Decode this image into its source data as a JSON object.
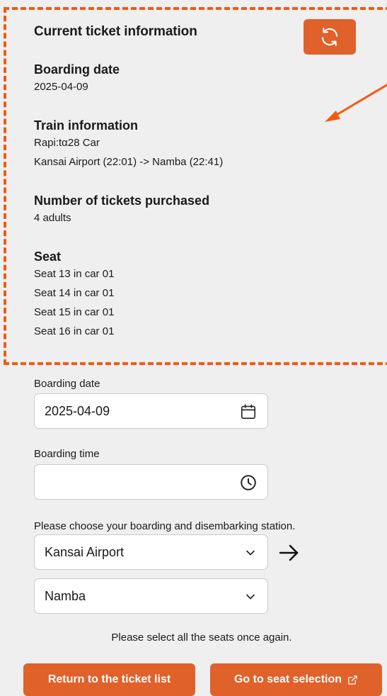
{
  "current_ticket": {
    "title": "Current ticket information",
    "boarding_date_label": "Boarding date",
    "boarding_date": "2025-04-09",
    "train_info_label": "Train information",
    "train_name": "Rapi:tα28 Car",
    "route": "Kansai Airport (22:01) -> Namba (22:41)",
    "tickets_label": "Number of tickets purchased",
    "tickets": "4 adults",
    "seat_label": "Seat",
    "seats": [
      "Seat 13 in car 01",
      "Seat 14 in car 01",
      "Seat 15 in car 01",
      "Seat 16 in car 01"
    ]
  },
  "form": {
    "boarding_date_label": "Boarding date",
    "boarding_date_value": "2025-04-09",
    "boarding_time_label": "Boarding time",
    "boarding_time_value": "",
    "station_prompt": "Please choose your boarding and disembarking station.",
    "from_station": "Kansai Airport",
    "to_station": "Namba"
  },
  "hint": "Please select all the seats once again.",
  "buttons": {
    "return": "Return to the ticket list",
    "seat_selection": "Go to seat selection"
  },
  "colors": {
    "accent": "#e0612a",
    "annotation": "#f25a12"
  },
  "icons": {
    "refresh": "refresh-icon",
    "calendar": "calendar-icon",
    "clock": "clock-icon",
    "chevron": "chevron-down-icon",
    "arrow": "arrow-right-icon",
    "external": "external-link-icon"
  }
}
